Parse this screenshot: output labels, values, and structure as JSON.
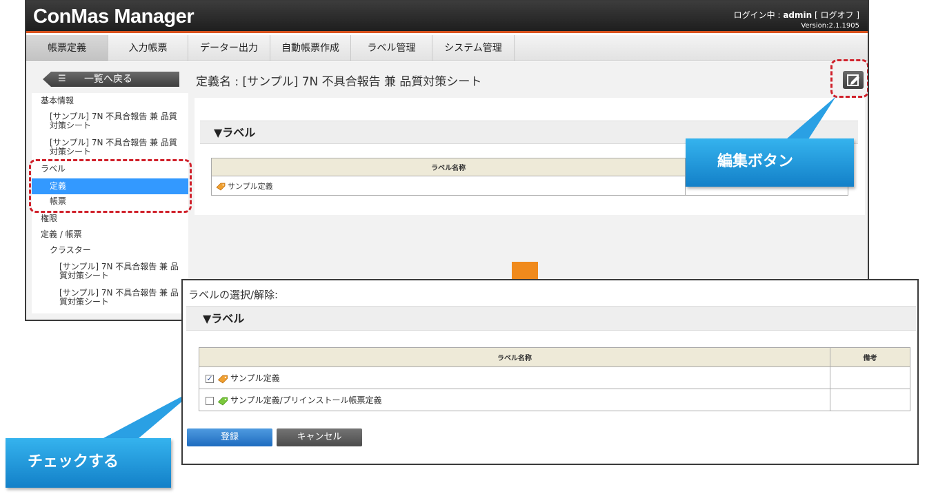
{
  "app": {
    "title": "ConMas Manager",
    "user_prefix": "ログイン中 : ",
    "user_name": "admin",
    "logoff": " [ ログオフ ]",
    "version": "Version:2.1.1905"
  },
  "nav": {
    "tabs": [
      "帳票定義",
      "入力帳票",
      "データー出力",
      "自動帳票作成",
      "ラベル管理",
      "システム管理"
    ],
    "active": "帳票定義"
  },
  "back_button": {
    "label": "一覧へ戻る",
    "icon": "list-icon"
  },
  "sidebar": {
    "basic_info": "基本情報",
    "item1_line1": "[サンプル] 7N 不具合報告 兼 品質",
    "item1_line2": "対策シート",
    "item2_line1": "[サンプル] 7N 不具合報告 兼 品質",
    "item2_line2": "対策シート",
    "label": "ラベル",
    "label_definition": "定義",
    "label_form": "帳票",
    "permission": "権限",
    "perm_def_form": "定義 / 帳票",
    "cluster": "クラスター",
    "cluster1_line1": "[サンプル] 7N 不具合報告 兼 品",
    "cluster1_line2": "質対策シート",
    "cluster2_line1": "[サンプル] 7N 不具合報告 兼 品",
    "cluster2_line2": "質対策シート"
  },
  "main": {
    "definition_title": "定義名 : [サンプル] 7N 不具合報告 兼 品質対策シート",
    "section": "▼ラベル",
    "table_header": "ラベル名称",
    "rows": [
      "サンプル定義"
    ]
  },
  "dialog": {
    "title": "ラベルの選択/解除:",
    "section": "▼ラベル",
    "col_name": "ラベル名称",
    "col_note": "備考",
    "rows": [
      {
        "label": "サンプル定義",
        "checked": true,
        "icon_color": "#f0a030"
      },
      {
        "label": "サンプル定義/プリインストール帳票定義",
        "checked": false,
        "icon_color": "#7cc83c"
      }
    ],
    "register": "登録",
    "cancel": "キャンセル"
  },
  "callouts": {
    "edit_button": "編集ボタン",
    "check": "チェックする"
  },
  "colors": {
    "accent": "#d9531e",
    "selection": "#3399ff",
    "callout": "#1e90d8",
    "highlight_dash": "#d0202a",
    "arrow": "#f08a1c"
  }
}
